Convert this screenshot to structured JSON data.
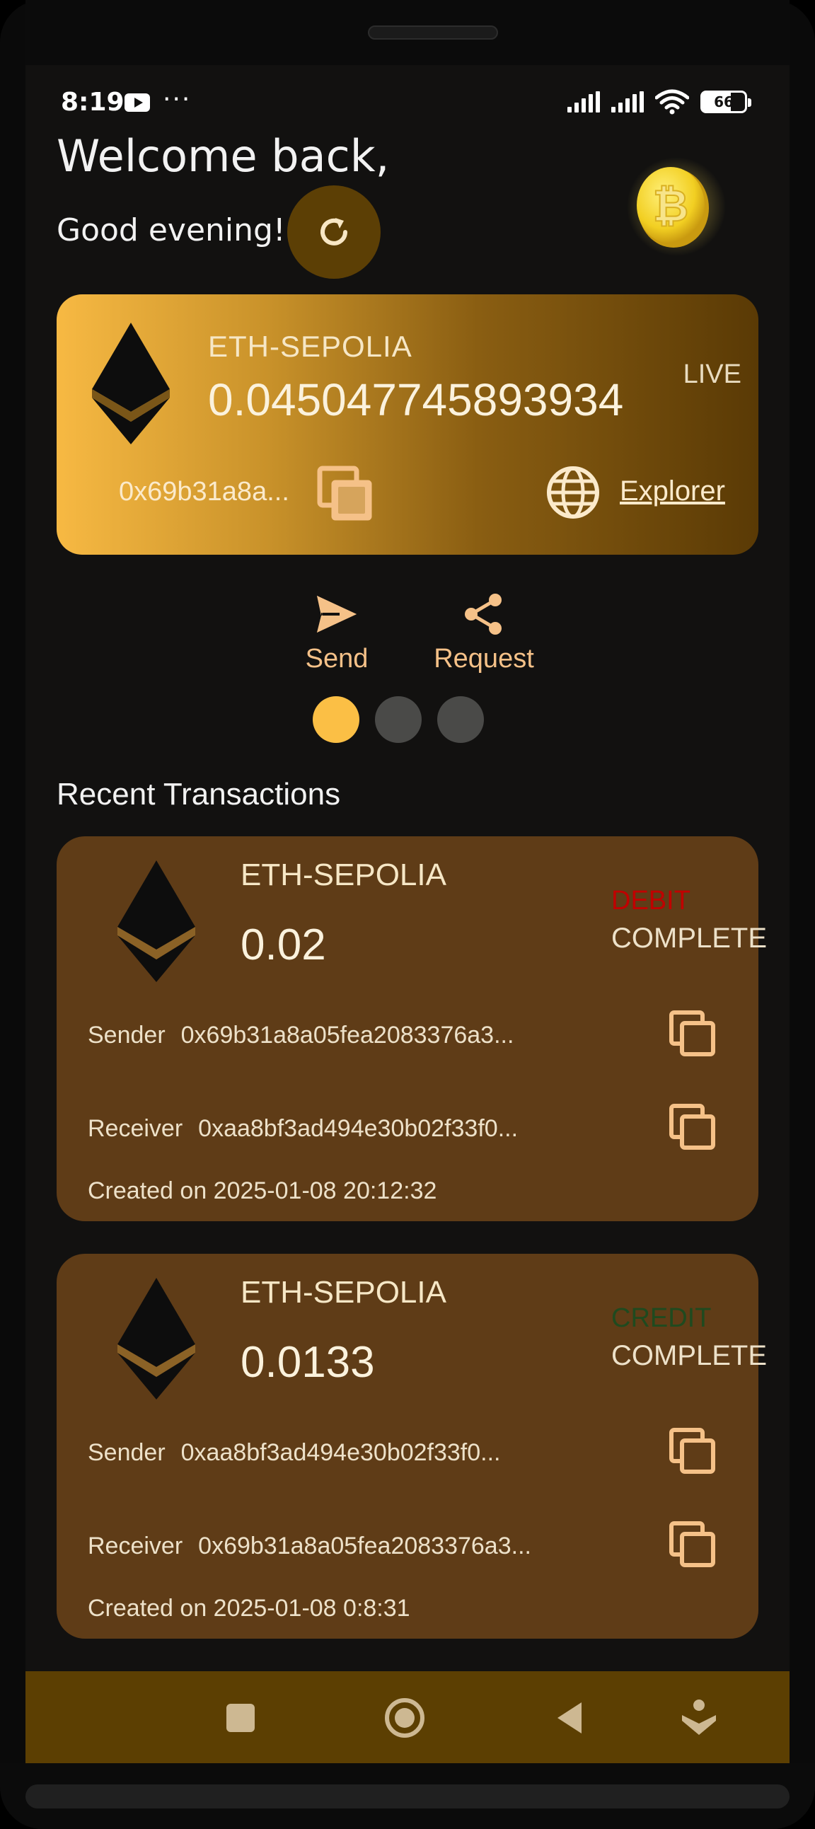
{
  "status_bar": {
    "time": "8:19",
    "more": "···",
    "battery": "66"
  },
  "header": {
    "welcome": "Welcome back,",
    "greeting": "Good evening!"
  },
  "wallet": {
    "network": "ETH-SEPOLIA",
    "balance": "0.045047745893934",
    "status": "LIVE",
    "address": "0x69b31a8a...",
    "explorer_label": "Explorer"
  },
  "actions": {
    "send": "Send",
    "request": "Request"
  },
  "pager": {
    "count": 3,
    "active": 0
  },
  "recent": {
    "title": "Recent Transactions",
    "transactions": [
      {
        "network": "ETH-SEPOLIA",
        "amount": "0.02",
        "type": "DEBIT",
        "type_color": "#c00000",
        "status": "COMPLETE",
        "sender_label": "Sender",
        "sender": "0x69b31a8a05fea2083376a3...",
        "receiver_label": "Receiver",
        "receiver": "0xaa8bf3ad494e30b02f33f0...",
        "created": "Created on 2025-01-08 20:12:32"
      },
      {
        "network": "ETH-SEPOLIA",
        "amount": "0.0133",
        "type": "CREDIT",
        "type_color": "#1f4a1f",
        "status": "COMPLETE",
        "sender_label": "Sender",
        "sender": "0xaa8bf3ad494e30b02f33f0...",
        "receiver_label": "Receiver",
        "receiver": "0x69b31a8a05fea2083376a3...",
        "created": "Created on 2025-01-08 0:8:31"
      }
    ]
  },
  "colors": {
    "accent": "#fbbf45",
    "card_bg": "#5f3c17",
    "nav_bg": "#5c3f02"
  },
  "icons": {
    "refresh": "refresh-icon",
    "coin": "bitcoin-coin-icon",
    "copy": "copy-icon",
    "globe": "globe-icon",
    "send": "send-icon",
    "share": "share-icon"
  }
}
